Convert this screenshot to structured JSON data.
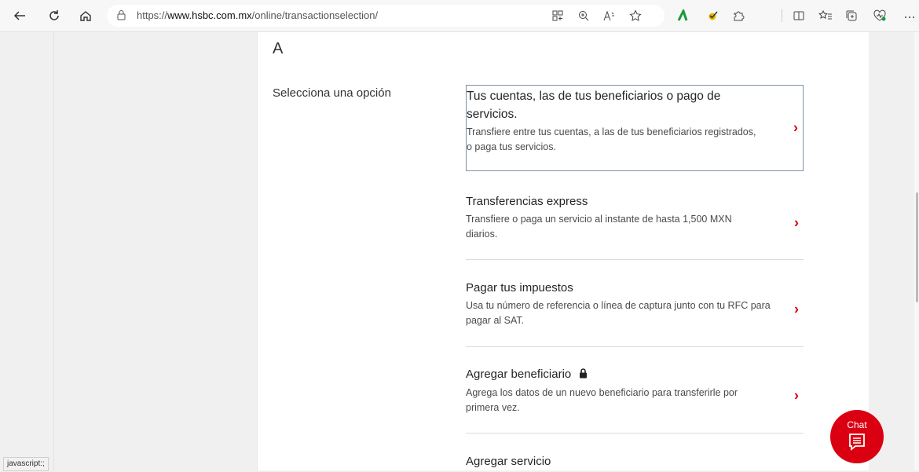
{
  "browser": {
    "url_prefix": "https://",
    "url_domain": "www.hsbc.com.mx",
    "url_path": "/online/transactionselection/"
  },
  "page": {
    "heading": "A",
    "select_label": "Selecciona una opción",
    "options": [
      {
        "title": "Tus cuentas, las de tus beneficiarios o pago de servicios.",
        "description": "Transfiere entre tus cuentas, a las de tus beneficiarios registrados, o paga tus servicios."
      },
      {
        "title": "Transferencias express",
        "description": "Transfiere o paga un servicio al instante de hasta 1,500 MXN diarios."
      },
      {
        "title": "Pagar tus impuestos",
        "description": "Usa tu número de referencia o línea de captura junto con tu RFC para pagar al SAT."
      },
      {
        "title": "Agregar beneficiario",
        "description": "Agrega los datos de un nuevo beneficiario para transferirle por primera vez."
      },
      {
        "title": "Agregar servicio",
        "description": ""
      }
    ],
    "chevron": "›"
  },
  "status_bar": {
    "text": "javascript:;"
  },
  "chat": {
    "label": "Chat"
  },
  "colors": {
    "accent": "#db0011"
  }
}
